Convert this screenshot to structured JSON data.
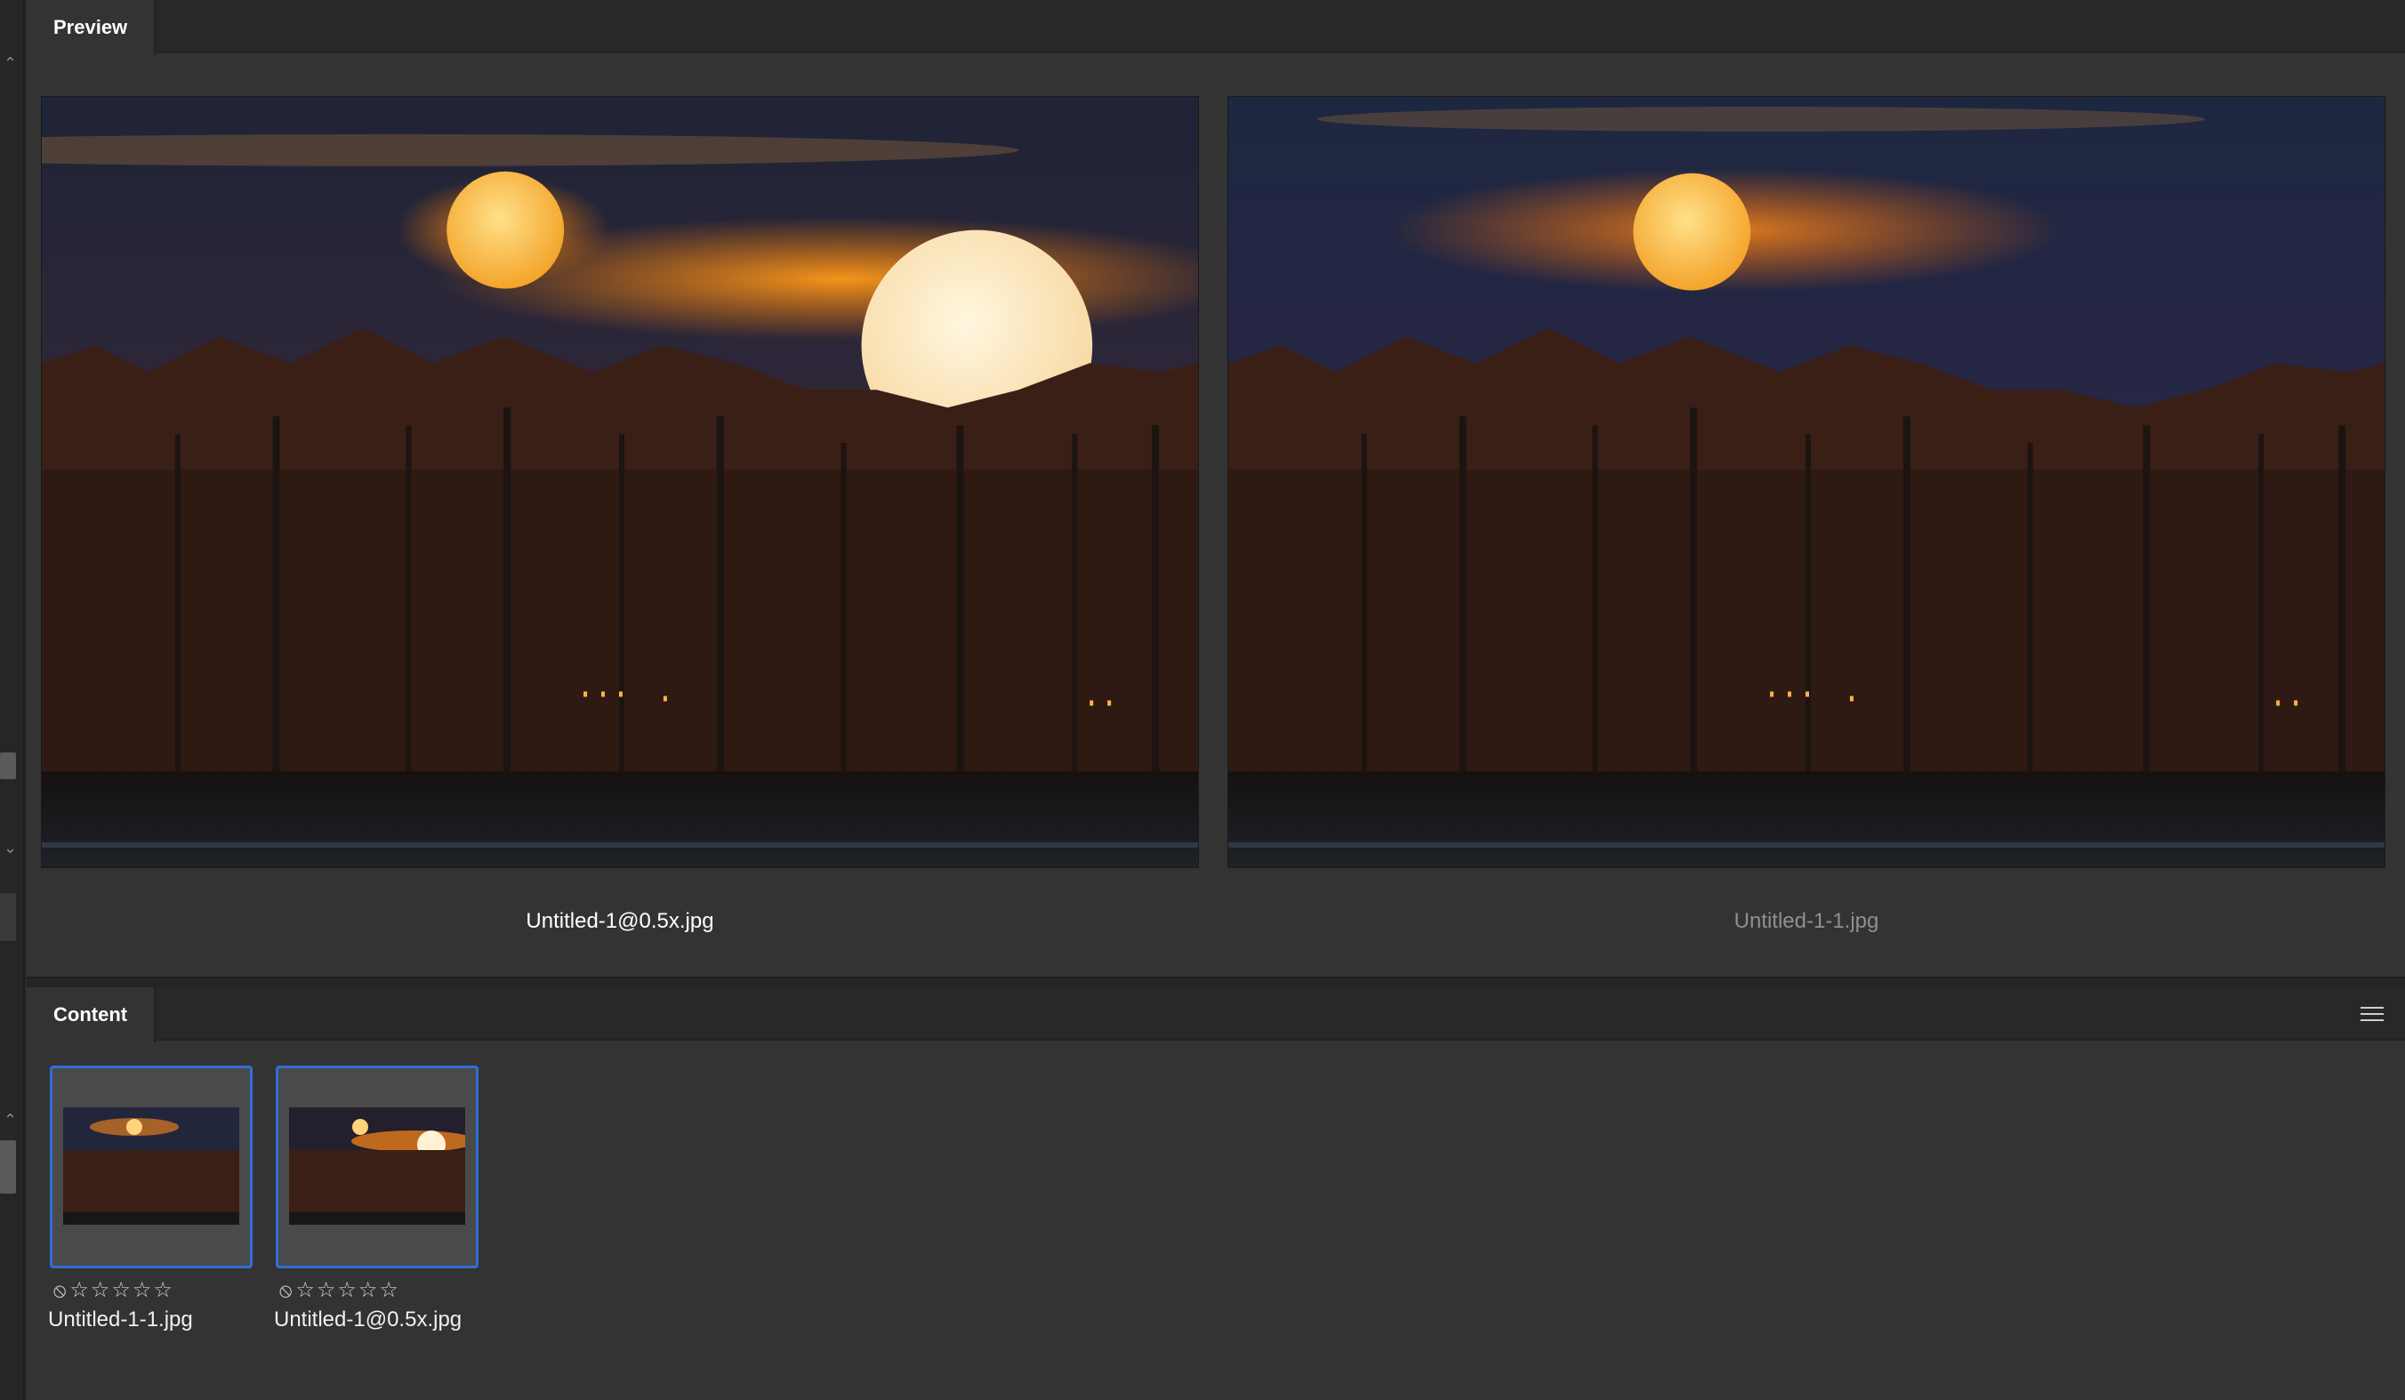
{
  "preview": {
    "tab_label": "Preview",
    "left_caption": "Untitled-1@0.5x.jpg",
    "right_caption": "Untitled-1-1.jpg"
  },
  "content": {
    "tab_label": "Content",
    "items": [
      {
        "filename": "Untitled-1-1.jpg",
        "rating": 0,
        "rating_max": 5
      },
      {
        "filename": "Untitled-1@0.5x.jpg",
        "rating": 0,
        "rating_max": 5
      }
    ]
  },
  "icons": {
    "reject": "⃠",
    "empty_star": "☆",
    "menu": "hamburger-menu-icon",
    "scroll_up": "⌃",
    "scroll_down": "⌄"
  },
  "colors": {
    "selection_border": "#2f6fd6",
    "panel_bg": "#333333",
    "header_bg": "#282828"
  }
}
